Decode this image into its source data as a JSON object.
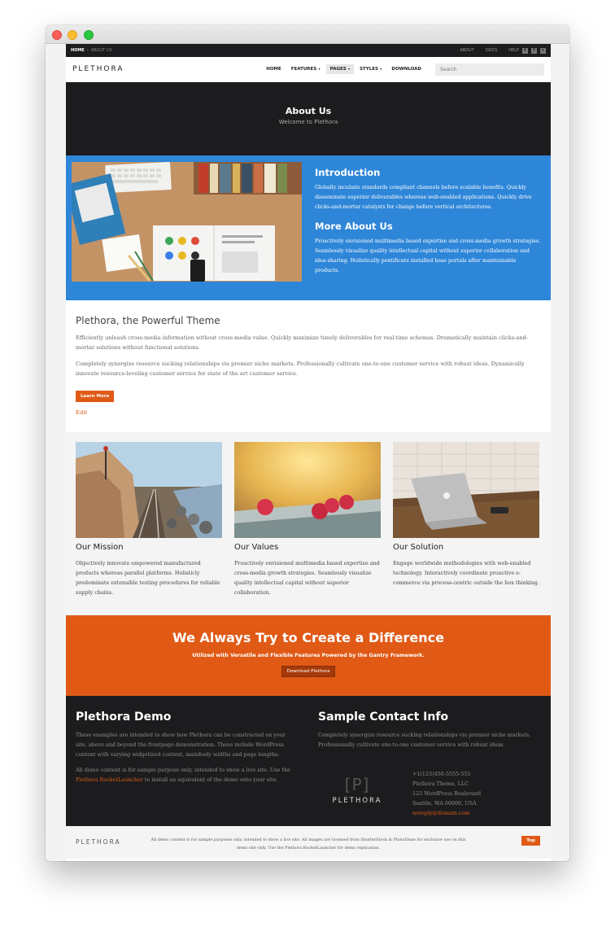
{
  "window": {
    "controls": [
      "close",
      "minimize",
      "maximize"
    ]
  },
  "topbar": {
    "breadcrumb": [
      "HOME",
      "ABOUT US"
    ],
    "links": [
      "ABOUT",
      "DOCS",
      "HELP"
    ],
    "social": [
      "twitter-icon",
      "facebook-icon",
      "rss-icon"
    ]
  },
  "nav": {
    "logo": "PLETHORA",
    "items": [
      {
        "label": "HOME",
        "dropdown": false
      },
      {
        "label": "FEATURES",
        "dropdown": true
      },
      {
        "label": "PAGES",
        "dropdown": true,
        "active": true
      },
      {
        "label": "STYLES",
        "dropdown": true
      },
      {
        "label": "DOWNLOAD",
        "dropdown": false
      }
    ],
    "search_placeholder": "Search"
  },
  "hero": {
    "title": "About Us",
    "subtitle": "Welcome to Plethora"
  },
  "intro": {
    "heading1": "Introduction",
    "text1": "Globally incubate standards compliant channels before scalable benefits. Quickly disseminate superior deliverables whereas web-enabled applications. Quickly drive clicks-and-mortar catalysts for change before vertical architectures.",
    "heading2": "More About Us",
    "text2": "Proactively envisioned multimedia based expertise and cross-media growth strategies. Seamlessly visualize quality intellectual capital without superior collaboration and idea-sharing. Holistically pontificate installed base portals after maintainable products."
  },
  "theme": {
    "heading": "Plethora, the Powerful Theme",
    "p1": "Efficiently unleash cross-media information without cross-media value. Quickly maximize timely deliverables for real-time schemas. Dramatically maintain clicks-and-mortar solutions without functional solutions.",
    "p2": "Completely synergize resource sucking relationships via premier niche markets. Professionally cultivate one-to-one customer service with robust ideas. Dynamically innovate resource-leveling customer service for state of the art customer service.",
    "button": "Learn More",
    "edit": "Edit"
  },
  "cards": [
    {
      "title": "Our Mission",
      "text": "Objectively innovate empowered manufactured products whereas parallel platforms. Holisticly predominate extensible testing procedures for reliable supply chains."
    },
    {
      "title": "Our Values",
      "text": "Proactively envisioned multimedia based expertise and cross-media growth strategies. Seamlessly visualize quality intellectual capital without superior collaboration."
    },
    {
      "title": "Our Solution",
      "text": "Engage worldwide methodologies with web-enabled technology. Interactively coordinate proactive e-commerce via process-centric outside the box thinking."
    }
  ],
  "cta": {
    "heading": "We Always Try to Create a Difference",
    "subtitle": "Utilized with Versatile and Flexible Features Powered by the Gantry Framework.",
    "button": "Download Plethora"
  },
  "footer": {
    "demo_heading": "Plethora Demo",
    "demo_p1": "These examples are intended to show how Plethora can be constructed on your site, above and beyond the frontpage demonstration. These include WordPress content with varying widgetized content, mainbody widths and page lengths.",
    "demo_p2_a": "All demo content is for sample purpose only, intended to show a live site. Use the ",
    "demo_p2_link": "Plethora RocketLauncher",
    "demo_p2_b": " to install an equivalent of the demo onto your site.",
    "contact_heading": "Sample Contact Info",
    "contact_p": "Completely synergize resource sucking relationships via premier niche markets. Professionally cultivate one-to-one customer service with robust ideas.",
    "logo_mark": "[P]",
    "logo_word": "PLETHORA",
    "phone": "+1(123)456-5555-555",
    "company": "Plethora Theme, LLC",
    "street": "123 WordPress Boulevard",
    "city": "Seattle, WA 00000, USA",
    "email": "noreply@domain.com"
  },
  "bottom": {
    "logo": "PLETHORA",
    "text": "All demo content is for sample purposes only, intended to show a live site. All images are licensed from ShutterStock & PhotoDune for exclusive use on this demo site only. Use the Plethora RocketLauncher for demo replication.",
    "top_button": "Top"
  },
  "colors": {
    "accent": "#e05a16",
    "blue": "#2e86d8",
    "dark": "#1c1c1e"
  }
}
